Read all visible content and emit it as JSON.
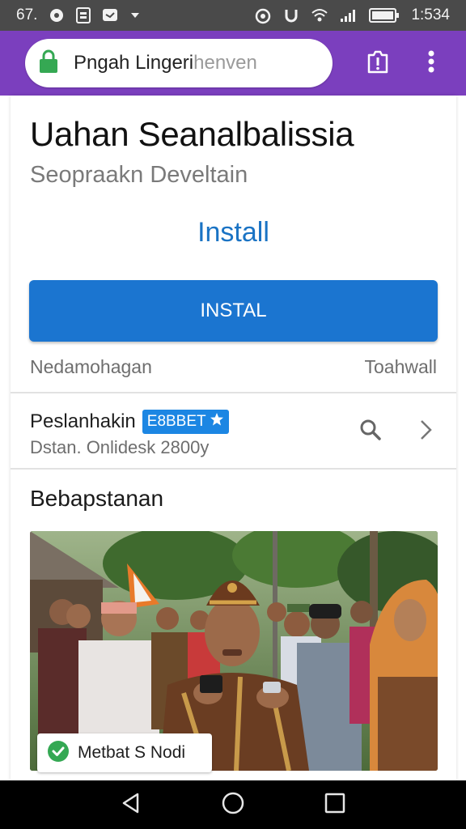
{
  "status_bar": {
    "left_text": "67.",
    "time": "1:534",
    "icons": [
      "notification-circle-icon",
      "image-notification-icon",
      "chat-notification-icon",
      "dropdown-arrow-icon",
      "alarm-icon",
      "sync-icon",
      "wifi-icon",
      "signal-icon",
      "battery-icon"
    ]
  },
  "browser": {
    "url_text": "Pngah Lingeri",
    "url_text_faded": "henven",
    "icons": [
      "lock-icon",
      "tabs-icon",
      "more-menu-icon"
    ]
  },
  "app": {
    "title": "Uahan Seanalbalissia",
    "developer": "Seopraakn Develtain",
    "install_link": "Install",
    "install_button": "INSTAL",
    "meta_left": "Nedamohagan",
    "meta_right": "Toahwall"
  },
  "row": {
    "title": "Peslanhakin",
    "badge": "E8BBET",
    "subtitle": "Dstan. Onlidesk 2800y"
  },
  "section": {
    "title": "Bebapstanan"
  },
  "photo_chip": {
    "label": "Metbat S Nodi"
  },
  "colors": {
    "accent": "#7b3fbe",
    "primary": "#1b75d0",
    "link": "#1a73c4",
    "check": "#34a853"
  }
}
